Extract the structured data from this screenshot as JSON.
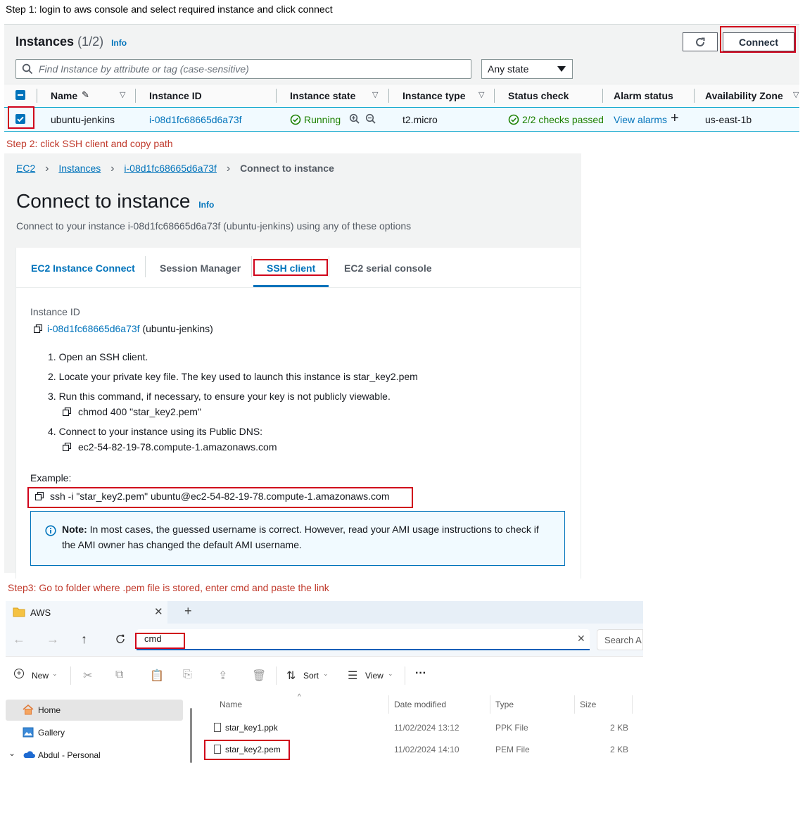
{
  "steps": {
    "step1": "Step 1: login to aws console and select required instance and click connect",
    "step2": "Step 2: click SSH client and copy path",
    "step3": "Step3: Go to folder where .pem file is stored, enter cmd and paste the link"
  },
  "instances": {
    "title": "Instances",
    "count": "(1/2)",
    "info": "Info",
    "connect_button": "Connect",
    "refresh_icon": "refresh-icon",
    "search_placeholder": "Find Instance by attribute or tag (case-sensitive)",
    "state_filter": "Any state",
    "columns": [
      "Name",
      "Instance ID",
      "Instance state",
      "Instance type",
      "Status check",
      "Alarm status",
      "Availability Zone"
    ],
    "row": {
      "name": "ubuntu-jenkins",
      "instance_id": "i-08d1fc68665d6a73f",
      "state": "Running",
      "type": "t2.micro",
      "status_check": "2/2 checks passed",
      "alarm": "View alarms",
      "zone": "us-east-1b"
    }
  },
  "connect": {
    "breadcrumb": [
      "EC2",
      "Instances",
      "i-08d1fc68665d6a73f",
      "Connect to instance"
    ],
    "title": "Connect to instance",
    "info": "Info",
    "subtitle": "Connect to your instance i-08d1fc68665d6a73f (ubuntu-jenkins) using any of these options",
    "tabs": [
      "EC2 Instance Connect",
      "Session Manager",
      "SSH client",
      "EC2 serial console"
    ],
    "active_tab": "SSH client",
    "instance_id_label": "Instance ID",
    "instance_id": "i-08d1fc68665d6a73f",
    "instance_name": "(ubuntu-jenkins)",
    "instructions": [
      "1. Open an SSH client.",
      "2. Locate your private key file. The key used to launch this instance is star_key2.pem",
      "3. Run this command, if necessary, to ensure your key is not publicly viewable.",
      "4. Connect to your instance using its Public DNS:"
    ],
    "chmod": "chmod 400 \"star_key2.pem\"",
    "dns": "ec2-54-82-19-78.compute-1.amazonaws.com",
    "example_label": "Example:",
    "example": "ssh -i \"star_key2.pem\" ubuntu@ec2-54-82-19-78.compute-1.amazonaws.com",
    "note_label": "Note:",
    "note_line1": "In most cases, the guessed username is correct. However, read your AMI usage instructions to check if",
    "note_line2": "the AMI owner has changed the default AMI username."
  },
  "explorer": {
    "tab_title": "AWS",
    "address": "cmd",
    "search": "Search A",
    "new": "New",
    "sort": "Sort",
    "view": "View",
    "more": "···",
    "nav": [
      "Home",
      "Gallery",
      "Abdul - Personal"
    ],
    "headers": [
      "Name",
      "Date modified",
      "Type",
      "Size"
    ],
    "files": [
      {
        "name": "star_key1.ppk",
        "date": "11/02/2024 13:12",
        "type": "PPK File",
        "size": "2 KB"
      },
      {
        "name": "star_key2.pem",
        "date": "11/02/2024 14:10",
        "type": "PEM File",
        "size": "2 KB"
      }
    ]
  },
  "colors": {
    "highlight": "#d0021b",
    "aws_link": "#0073bb",
    "running": "#1d8102",
    "step_red": "#c0392b"
  }
}
